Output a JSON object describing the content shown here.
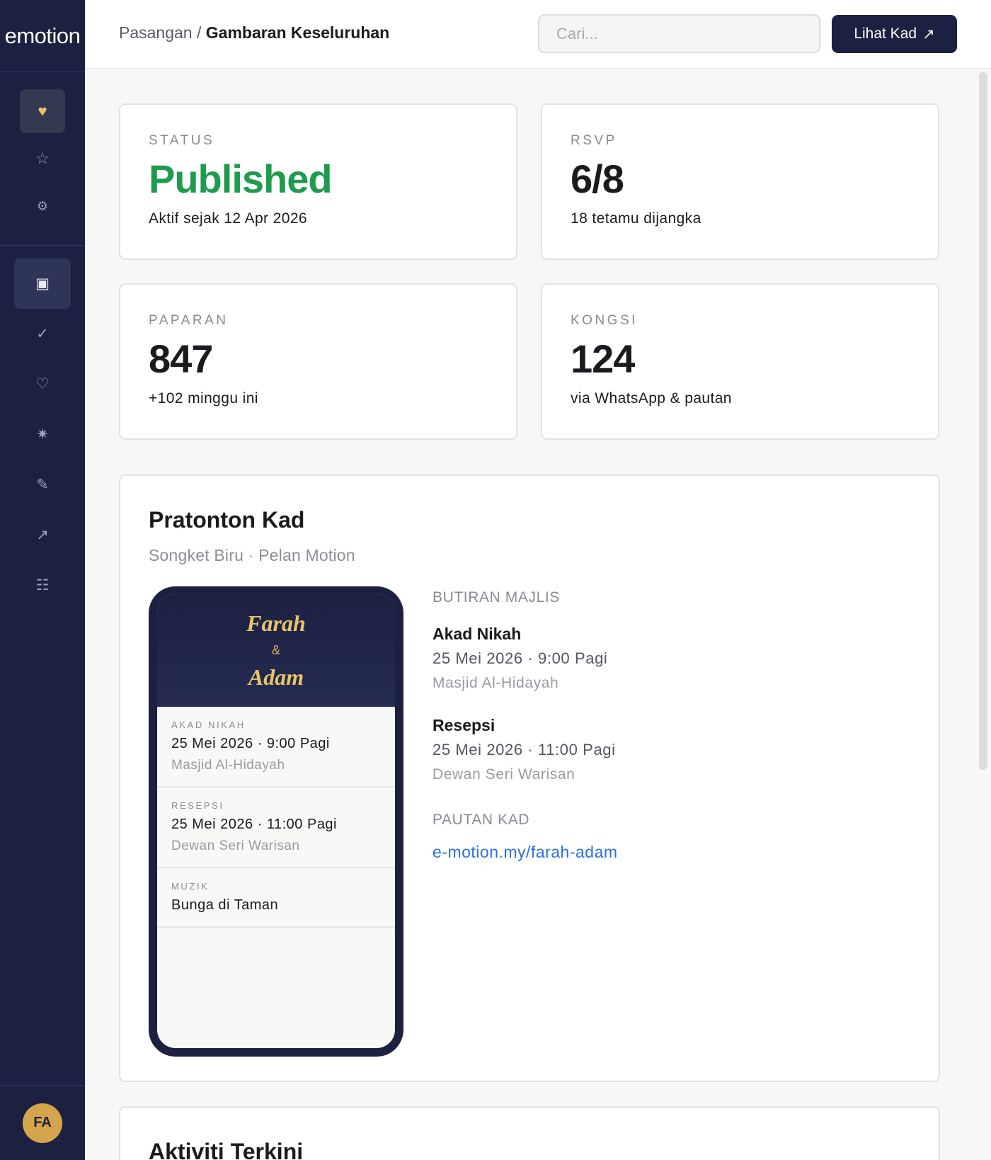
{
  "brand": "emotion",
  "user_initials": "FA",
  "header": {
    "breadcrumb_parent": "Pasangan",
    "breadcrumb_separator": "/",
    "breadcrumb_current": "Gambaran Keseluruhan",
    "search_placeholder": "Cari...",
    "view_button": "Lihat Kad",
    "view_button_icon": "↗"
  },
  "sidebar": {
    "top_icons": [
      {
        "name": "heart-icon",
        "glyph": "♥"
      },
      {
        "name": "star-icon",
        "glyph": "☆"
      },
      {
        "name": "settings-icon",
        "glyph": "⚙"
      }
    ],
    "nav_icons": [
      {
        "name": "overview-icon",
        "glyph": "▣"
      },
      {
        "name": "check-icon",
        "glyph": "✓"
      },
      {
        "name": "heart-outline-icon",
        "glyph": "♡"
      },
      {
        "name": "sparkle-icon",
        "glyph": "✷"
      },
      {
        "name": "pencil-icon",
        "glyph": "✎"
      },
      {
        "name": "share-arrow-icon",
        "glyph": "↗"
      },
      {
        "name": "list-icon",
        "glyph": "☷"
      }
    ]
  },
  "stats": {
    "status": {
      "label": "STATUS",
      "value": "Published",
      "sub": "Aktif sejak 12 Apr 2026"
    },
    "rsvp": {
      "label": "RSVP",
      "value": "6/8",
      "sub": "18 tetamu dijangka"
    },
    "views": {
      "label": "PAPARAN",
      "value": "847",
      "sub": "+102 minggu ini"
    },
    "shares": {
      "label": "KONGSI",
      "value": "124",
      "sub": "via WhatsApp & pautan"
    }
  },
  "preview": {
    "title": "Pratonton Kad",
    "tagline": "Songket Biru · Pelan Motion",
    "phone": {
      "name1": "Farah",
      "amp": "&",
      "name2": "Adam",
      "rows": [
        {
          "caption": "AKAD NIKAH",
          "line1": "25 Mei 2026 · 9:00 Pagi",
          "line2": "Masjid Al-Hidayah"
        },
        {
          "caption": "RESEPSI",
          "line1": "25 Mei 2026 · 11:00 Pagi",
          "line2": "Dewan Seri Warisan"
        },
        {
          "caption": "MUZIK",
          "line1": "Bunga di Taman"
        }
      ]
    },
    "details_title": "BUTIRAN MAJLIS",
    "events": [
      {
        "title": "Akad Nikah",
        "datetime": "25 Mei 2026 · 9:00 Pagi",
        "place": "Masjid Al-Hidayah"
      },
      {
        "title": "Resepsi",
        "datetime": "25 Mei 2026 · 11:00 Pagi",
        "place": "Dewan Seri Warisan"
      }
    ],
    "link_title": "PAUTAN KAD",
    "link": "e-motion.my/farah-adam"
  },
  "activity": {
    "title": "Aktiviti Terkini"
  },
  "colors": {
    "sidebar_bg": "#1c2141",
    "accent_gold": "#e9c46a",
    "success_green": "#1f9b4e",
    "link_blue": "#2c6fd8"
  }
}
